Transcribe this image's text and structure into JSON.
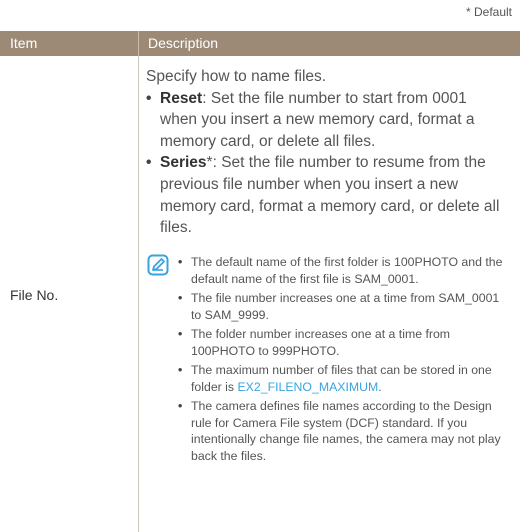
{
  "default_note": "* Default",
  "header": {
    "item": "Item",
    "description": "Description"
  },
  "row": {
    "item": "File No.",
    "intro": "Specify how to name files.",
    "options": [
      {
        "name": "Reset",
        "suffix": "",
        "text": ": Set the file number to start from 0001 when you insert a new memory card, format a memory card, or delete all files."
      },
      {
        "name": "Series",
        "suffix": "*",
        "text": ": Set the file number to resume from the previous file number when you insert a new memory card, format a memory card, or delete all files."
      }
    ],
    "note_icon": "note-pencil-icon",
    "notes": [
      "The default name of the first folder is 100PHOTO and the default name of the first file is SAM_0001.",
      "The file number increases one at a time from SAM_0001 to SAM_9999.",
      "The folder number increases one at a time from 100PHOTO to 999PHOTO."
    ],
    "note_max_prefix": "The maximum number of files that can be stored in one folder is ",
    "note_max_link": "EX2_FILENO_MAXIMUM",
    "note_max_suffix": ".",
    "note_dcf": "The camera defines file names according to the Design rule for Camera File system (DCF) standard. If you intentionally change file names, the camera may not play back the files."
  },
  "colors": {
    "header_bg": "#9c8a76",
    "link": "#3aa3dd"
  }
}
